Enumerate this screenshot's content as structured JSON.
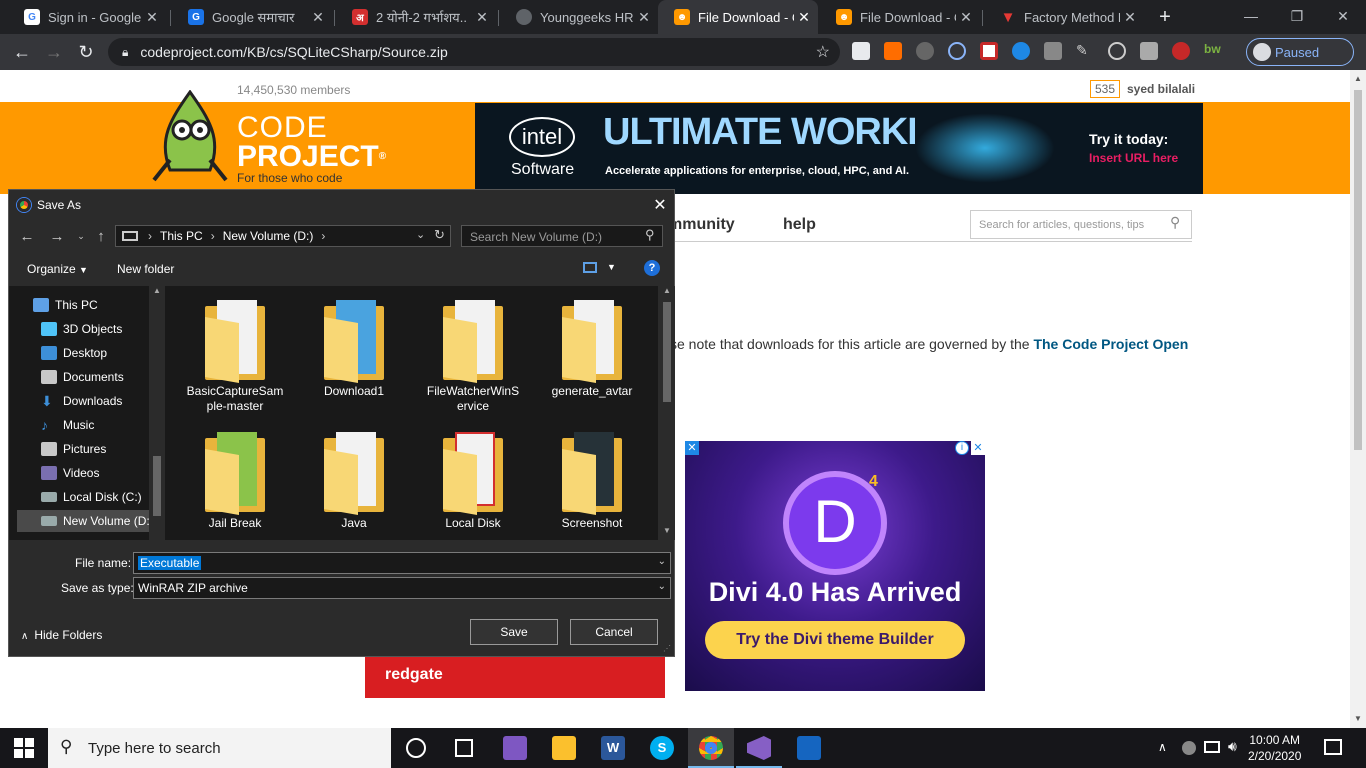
{
  "tabs": [
    {
      "title": "Sign in - Google A",
      "favicon": "google-g-icon",
      "color": "#4285f4"
    },
    {
      "title": "Google समाचार",
      "favicon": "google-news-icon",
      "color": "#1a73e8"
    },
    {
      "title": "2 योनी-2 गर्भाशय..",
      "favicon": "news-site-icon",
      "color": "#d32f2f"
    },
    {
      "title": "Younggeeks HRM",
      "favicon": "globe-icon",
      "color": "#5f6368"
    },
    {
      "title": "File Download - C",
      "favicon": "codeproject-icon",
      "color": "#f90",
      "active": true
    },
    {
      "title": "File Download - C",
      "favicon": "codeproject-icon",
      "color": "#f90"
    },
    {
      "title": "Factory Method D",
      "favicon": "red-v-icon",
      "color": "#e53935"
    }
  ],
  "url": "codeproject.com/KB/cs/SQLiteCSharp/Source.zip",
  "profile": {
    "label": "Paused"
  },
  "page": {
    "members": "14,450,530 members",
    "reputation": "535",
    "username": "syed bilalali",
    "logo_line1": "CODE",
    "logo_line2": "PROJECT",
    "logo_reg": "®",
    "logo_tagline": "For those who code",
    "nav_community": "mmunity",
    "nav_help": "help",
    "search_placeholder": "Search for articles, questions, tips",
    "note_text": "se note that downloads for this article are governed by the ",
    "note_link": "The Code Project Open",
    "banner": {
      "brand": "intel",
      "brand_sub": "Software",
      "headline": "ULTIMATE WORKHORSE",
      "subline": "Accelerate applications for enterprise, cloud, HPC, and AI.",
      "cta": "Try it today:",
      "cta_link": "Insert URL here"
    },
    "ad": {
      "logo_letter": "D",
      "badge": "4",
      "headline": "Divi 4.0 Has Arrived",
      "button": "Try the Divi theme Builder"
    },
    "redgate": "redgate"
  },
  "dialog": {
    "title": "Save As",
    "path": [
      "This PC",
      "New Volume (D:)"
    ],
    "search_placeholder": "Search New Volume (D:)",
    "organize": "Organize",
    "new_folder": "New folder",
    "tree": [
      {
        "label": "This PC",
        "icon": "pc-icon",
        "color": "#5ea0e6",
        "indent": 0
      },
      {
        "label": "3D Objects",
        "icon": "3d-objects-icon",
        "color": "#4fc3f7",
        "indent": 1
      },
      {
        "label": "Desktop",
        "icon": "desktop-icon",
        "color": "#3d8fd8",
        "indent": 1
      },
      {
        "label": "Documents",
        "icon": "documents-icon",
        "color": "#c8c8c8",
        "indent": 1
      },
      {
        "label": "Downloads",
        "icon": "downloads-icon",
        "color": "#3d8fd8",
        "indent": 1
      },
      {
        "label": "Music",
        "icon": "music-icon",
        "color": "#3d8fd8",
        "indent": 1
      },
      {
        "label": "Pictures",
        "icon": "pictures-icon",
        "color": "#c8c8c8",
        "indent": 1
      },
      {
        "label": "Videos",
        "icon": "videos-icon",
        "color": "#7a6fb0",
        "indent": 1
      },
      {
        "label": "Local Disk (C:)",
        "icon": "drive-icon",
        "color": "#9aa",
        "indent": 1
      },
      {
        "label": "New Volume (D:",
        "icon": "drive-icon",
        "color": "#9aa",
        "indent": 1,
        "selected": true
      }
    ],
    "files": [
      {
        "name": "BasicCaptureSam ple-master",
        "icon": "folder-icon"
      },
      {
        "name": "Download1",
        "icon": "folder-icon"
      },
      {
        "name": "FileWatcherWinS ervice",
        "icon": "folder-icon"
      },
      {
        "name": "generate_avtar",
        "icon": "folder-icon"
      },
      {
        "name": "Jail Break",
        "icon": "folder-icon"
      },
      {
        "name": "Java",
        "icon": "folder-icon"
      },
      {
        "name": "Local Disk",
        "icon": "folder-icon"
      },
      {
        "name": "Screenshot",
        "icon": "folder-icon"
      }
    ],
    "file_name_label": "File name:",
    "file_name_value": "Executable",
    "save_type_label": "Save as type:",
    "save_type_value": "WinRAR ZIP archive",
    "hide_folders": "Hide Folders",
    "save": "Save",
    "cancel": "Cancel"
  },
  "taskbar": {
    "search_placeholder": "Type here to search",
    "time": "10:00 AM",
    "date": "2/20/2020"
  }
}
